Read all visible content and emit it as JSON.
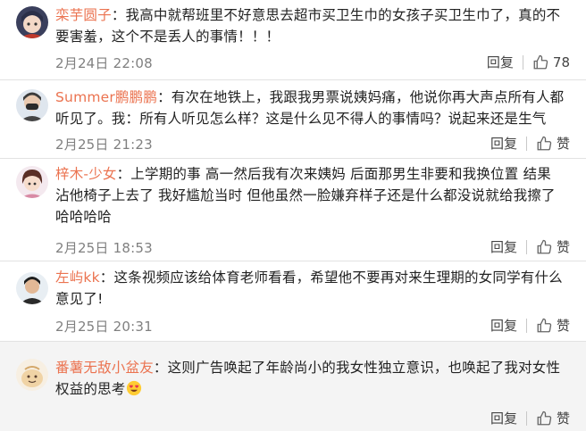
{
  "comments": [
    {
      "user": "栾芋圆子",
      "text": "我高中就帮班里不好意思去超市买卫生巾的女孩子买卫生巾了，真的不要害羞，这个不是丢人的事情！！！",
      "time": "2月24日 22:08",
      "reply_label": "回复",
      "like_label": "78",
      "avatar_icon": "avatar-anime-girl-icon"
    },
    {
      "user": "Summer鹏鹏鹏",
      "text": "有次在地铁上，我跟我男票说姨妈痛，他说你再大声点所有人都听见了。我：所有人听见怎么样？这是什么见不得人的事情吗？说起来还是生气",
      "time": "2月25日 21:23",
      "reply_label": "回复",
      "like_label": "赞",
      "avatar_icon": "avatar-masked-person-icon"
    },
    {
      "user": "梓木-少女",
      "text": "上学期的事 高一然后我有次来姨妈 后面那男生非要和我换位置 结果沾他椅子上去了 我好尴尬当时 但他虽然一脸嫌弃样子还是什么都没说就给我擦了哈哈哈哈",
      "time": "2月25日 18:53",
      "reply_label": "回复",
      "like_label": "赞",
      "avatar_icon": "avatar-anime-girl-icon"
    },
    {
      "user": "左屿kk",
      "text": "这条视频应该给体育老师看看，希望他不要再对来生理期的女同学有什么意见了!",
      "time": "2月25日 20:31",
      "reply_label": "回复",
      "like_label": "赞",
      "avatar_icon": "avatar-person-icon"
    },
    {
      "user": "番薯无敌小盆友",
      "text": "这则广告唤起了年龄尚小的我女性独立意识，也唤起了我对女性权益的思考",
      "emoji_icon": "heart-eyes-emoji-icon",
      "reply_label": "回复",
      "like_label": "赞",
      "avatar_icon": "avatar-cartoon-icon"
    }
  ],
  "colors": {
    "username": "#eb7350",
    "timestamp": "#808080",
    "divider": "#e2e2e2",
    "last_row_bg": "#f4f4f4"
  }
}
